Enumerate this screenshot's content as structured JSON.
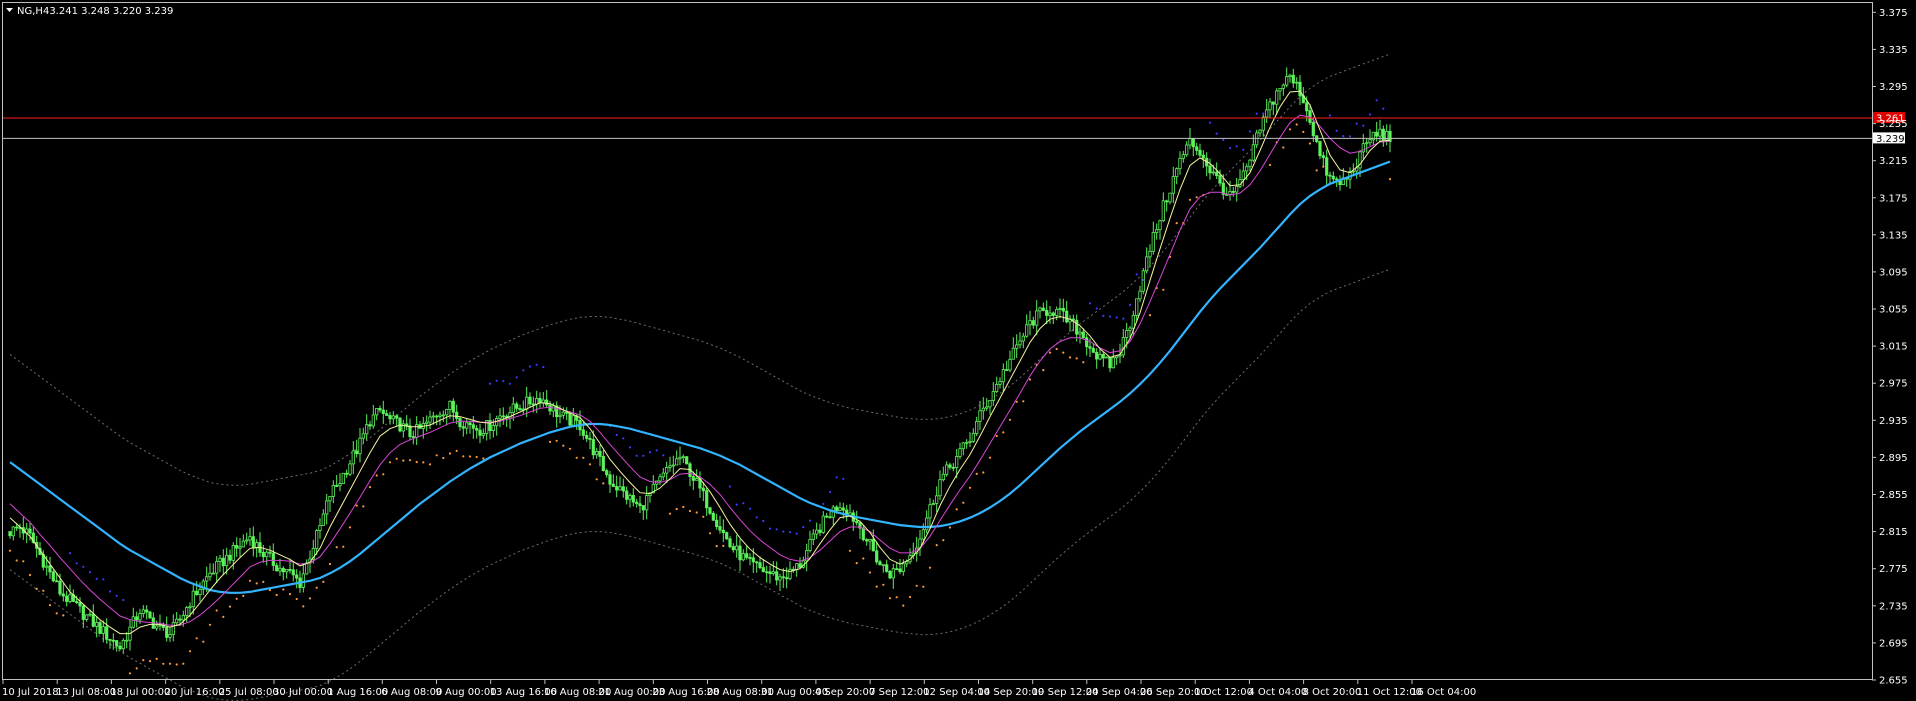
{
  "window": {
    "symbol": "NG",
    "timeframe": "H4",
    "ohlc": "3.241 3.248 3.220 3.239",
    "menu_icon": "triangle-down-icon"
  },
  "colors": {
    "background": "#000000",
    "frame": "#c0c0c0",
    "candle": "#5df25d",
    "ma_slow": "#32b4ff",
    "ma_mid": "#d946d9",
    "ma_fast": "#f5f5a0",
    "envelope": "#6e6e6e",
    "sar_up": "#3b3bff",
    "sar_down": "#ff9a3c",
    "hline_red": "#ff2020",
    "hline_gray": "#c0c0c0",
    "label_red_bg": "#e00000",
    "label_gray_bg": "#ffffff"
  },
  "chart_data": {
    "type": "line",
    "ylim": [
      2.655,
      3.385
    ],
    "y_ticks": [
      "3.375",
      "3.335",
      "3.295",
      "3.255",
      "3.215",
      "3.175",
      "3.135",
      "3.095",
      "3.055",
      "3.015",
      "2.975",
      "2.935",
      "2.895",
      "2.855",
      "2.815",
      "2.775",
      "2.735",
      "2.695",
      "2.655"
    ],
    "x_ticks": [
      "10 Jul 2018",
      "13 Jul 08:00",
      "18 Jul 00:00",
      "20 Jul 16:00",
      "25 Jul 08:00",
      "30 Jul 00:00",
      "1 Aug 16:00",
      "6 Aug 08:00",
      "9 Aug 00:00",
      "13 Aug 16:00",
      "16 Aug 08:00",
      "21 Aug 00:00",
      "23 Aug 16:00",
      "28 Aug 08:00",
      "31 Aug 00:00",
      "4 Sep 20:00",
      "7 Sep 12:00",
      "12 Sep 04:00",
      "14 Sep 20:00",
      "19 Sep 12:00",
      "24 Sep 04:00",
      "26 Sep 20:00",
      "1 Oct 12:00",
      "4 Oct 04:00",
      "8 Oct 20:00",
      "11 Oct 12:00",
      "16 Oct 04:00"
    ],
    "price_levels": [
      {
        "value": 3.261,
        "label": "3.261",
        "color": "red"
      },
      {
        "value": 3.239,
        "label": "3.239",
        "color": "gray"
      }
    ],
    "series": [
      {
        "role": "price",
        "values": [
          2.815,
          2.82,
          2.81,
          2.79,
          2.77,
          2.75,
          2.74,
          2.73,
          2.72,
          2.71,
          2.7,
          2.69,
          2.71,
          2.73,
          2.72,
          2.71,
          2.705,
          2.72,
          2.74,
          2.755,
          2.77,
          2.78,
          2.79,
          2.8,
          2.81,
          2.795,
          2.785,
          2.775,
          2.77,
          2.76,
          2.79,
          2.82,
          2.855,
          2.87,
          2.89,
          2.91,
          2.935,
          2.945,
          2.935,
          2.93,
          2.92,
          2.925,
          2.935,
          2.945,
          2.95,
          2.935,
          2.93,
          2.925,
          2.93,
          2.94,
          2.945,
          2.95,
          2.955,
          2.96,
          2.95,
          2.94,
          2.935,
          2.93,
          2.91,
          2.89,
          2.87,
          2.86,
          2.85,
          2.84,
          2.855,
          2.87,
          2.885,
          2.895,
          2.88,
          2.86,
          2.84,
          2.82,
          2.8,
          2.79,
          2.78,
          2.775,
          2.77,
          2.765,
          2.77,
          2.78,
          2.8,
          2.82,
          2.835,
          2.845,
          2.835,
          2.82,
          2.8,
          2.78,
          2.77,
          2.775,
          2.79,
          2.81,
          2.84,
          2.87,
          2.885,
          2.9,
          2.915,
          2.94,
          2.96,
          2.98,
          3.0,
          3.02,
          3.04,
          3.05,
          3.055,
          3.05,
          3.04,
          3.03,
          3.015,
          3.0,
          2.995,
          3.01,
          3.04,
          3.08,
          3.12,
          3.155,
          3.185,
          3.215,
          3.235,
          3.225,
          3.205,
          3.19,
          3.175,
          3.19,
          3.215,
          3.25,
          3.275,
          3.295,
          3.305,
          3.29,
          3.26,
          3.22,
          3.195,
          3.19,
          3.2,
          3.22,
          3.24,
          3.245,
          3.239
        ]
      },
      {
        "role": "ma_fast",
        "values": [
          2.83,
          2.82,
          2.81,
          2.795,
          2.78,
          2.765,
          2.75,
          2.74,
          2.73,
          2.72,
          2.712,
          2.705,
          2.705,
          2.712,
          2.715,
          2.715,
          2.712,
          2.715,
          2.725,
          2.738,
          2.752,
          2.765,
          2.776,
          2.787,
          2.797,
          2.798,
          2.795,
          2.79,
          2.785,
          2.778,
          2.782,
          2.797,
          2.82,
          2.84,
          2.86,
          2.88,
          2.9,
          2.918,
          2.926,
          2.93,
          2.928,
          2.928,
          2.93,
          2.935,
          2.94,
          2.939,
          2.936,
          2.933,
          2.932,
          2.935,
          2.939,
          2.944,
          2.949,
          2.954,
          2.953,
          2.948,
          2.943,
          2.938,
          2.926,
          2.91,
          2.893,
          2.88,
          2.868,
          2.857,
          2.856,
          2.862,
          2.872,
          2.883,
          2.882,
          2.872,
          2.858,
          2.841,
          2.823,
          2.808,
          2.796,
          2.787,
          2.78,
          2.774,
          2.772,
          2.775,
          2.786,
          2.802,
          2.817,
          2.83,
          2.832,
          2.826,
          2.814,
          2.798,
          2.785,
          2.78,
          2.785,
          2.797,
          2.818,
          2.843,
          2.864,
          2.882,
          2.898,
          2.918,
          2.939,
          2.959,
          2.979,
          2.999,
          3.019,
          3.034,
          3.044,
          3.047,
          3.044,
          3.037,
          3.026,
          3.012,
          3.003,
          3.006,
          3.023,
          3.051,
          3.086,
          3.12,
          3.153,
          3.184,
          3.21,
          3.218,
          3.212,
          3.201,
          3.188,
          3.189,
          3.202,
          3.226,
          3.251,
          3.273,
          3.289,
          3.29,
          3.275,
          3.248,
          3.221,
          3.205,
          3.202,
          3.211,
          3.226,
          3.236,
          3.237
        ]
      },
      {
        "role": "ma_mid",
        "values": [
          2.845,
          2.835,
          2.825,
          2.812,
          2.8,
          2.787,
          2.775,
          2.763,
          2.752,
          2.742,
          2.733,
          2.724,
          2.72,
          2.718,
          2.717,
          2.716,
          2.714,
          2.714,
          2.718,
          2.725,
          2.734,
          2.744,
          2.755,
          2.766,
          2.777,
          2.782,
          2.784,
          2.784,
          2.783,
          2.78,
          2.781,
          2.788,
          2.802,
          2.818,
          2.835,
          2.852,
          2.87,
          2.887,
          2.9,
          2.909,
          2.914,
          2.918,
          2.922,
          2.927,
          2.932,
          2.934,
          2.934,
          2.933,
          2.933,
          2.934,
          2.937,
          2.94,
          2.944,
          2.948,
          2.949,
          2.947,
          2.944,
          2.941,
          2.934,
          2.922,
          2.909,
          2.897,
          2.885,
          2.874,
          2.869,
          2.868,
          2.871,
          2.877,
          2.878,
          2.874,
          2.866,
          2.855,
          2.841,
          2.828,
          2.816,
          2.806,
          2.798,
          2.79,
          2.785,
          2.783,
          2.787,
          2.795,
          2.805,
          2.815,
          2.82,
          2.82,
          2.815,
          2.806,
          2.797,
          2.792,
          2.792,
          2.797,
          2.81,
          2.827,
          2.844,
          2.86,
          2.875,
          2.892,
          2.91,
          2.928,
          2.946,
          2.964,
          2.983,
          2.999,
          3.012,
          3.02,
          3.024,
          3.024,
          3.02,
          3.013,
          3.008,
          3.01,
          3.02,
          3.039,
          3.063,
          3.088,
          3.114,
          3.14,
          3.163,
          3.176,
          3.181,
          3.181,
          3.178,
          3.18,
          3.189,
          3.204,
          3.222,
          3.24,
          3.256,
          3.264,
          3.262,
          3.252,
          3.239,
          3.229,
          3.223,
          3.225,
          3.23,
          3.235,
          3.236
        ]
      },
      {
        "role": "ma_slow",
        "values": [
          2.89,
          2.882,
          2.874,
          2.866,
          2.858,
          2.85,
          2.842,
          2.834,
          2.826,
          2.818,
          2.81,
          2.802,
          2.795,
          2.789,
          2.783,
          2.777,
          2.771,
          2.765,
          2.76,
          2.756,
          2.752,
          2.75,
          2.749,
          2.749,
          2.75,
          2.752,
          2.754,
          2.756,
          2.758,
          2.76,
          2.762,
          2.765,
          2.77,
          2.776,
          2.783,
          2.791,
          2.8,
          2.809,
          2.818,
          2.827,
          2.836,
          2.845,
          2.853,
          2.861,
          2.869,
          2.876,
          2.883,
          2.889,
          2.895,
          2.9,
          2.905,
          2.91,
          2.914,
          2.918,
          2.922,
          2.925,
          2.928,
          2.93,
          2.931,
          2.931,
          2.93,
          2.928,
          2.926,
          2.923,
          2.92,
          2.917,
          2.914,
          2.911,
          2.908,
          2.905,
          2.901,
          2.897,
          2.892,
          2.887,
          2.881,
          2.875,
          2.869,
          2.863,
          2.857,
          2.851,
          2.846,
          2.842,
          2.838,
          2.835,
          2.832,
          2.83,
          2.828,
          2.826,
          2.824,
          2.822,
          2.821,
          2.82,
          2.82,
          2.821,
          2.823,
          2.826,
          2.83,
          2.835,
          2.841,
          2.848,
          2.856,
          2.865,
          2.875,
          2.885,
          2.895,
          2.905,
          2.914,
          2.923,
          2.931,
          2.939,
          2.947,
          2.955,
          2.964,
          2.974,
          2.985,
          2.997,
          3.01,
          3.024,
          3.038,
          3.052,
          3.065,
          3.077,
          3.088,
          3.099,
          3.11,
          3.121,
          3.133,
          3.145,
          3.157,
          3.168,
          3.177,
          3.184,
          3.19,
          3.194,
          3.198,
          3.202,
          3.206,
          3.21,
          3.214
        ]
      },
      {
        "role": "envelope_upper",
        "values": [
          3.006,
          2.998,
          2.99,
          2.982,
          2.974,
          2.966,
          2.958,
          2.95,
          2.942,
          2.934,
          2.926,
          2.918,
          2.911,
          2.905,
          2.899,
          2.893,
          2.887,
          2.881,
          2.876,
          2.872,
          2.868,
          2.866,
          2.865,
          2.865,
          2.866,
          2.868,
          2.87,
          2.872,
          2.874,
          2.876,
          2.878,
          2.881,
          2.886,
          2.892,
          2.899,
          2.907,
          2.916,
          2.925,
          2.934,
          2.943,
          2.952,
          2.961,
          2.969,
          2.977,
          2.985,
          2.992,
          2.999,
          3.005,
          3.011,
          3.016,
          3.021,
          3.026,
          3.03,
          3.034,
          3.038,
          3.041,
          3.044,
          3.046,
          3.047,
          3.047,
          3.046,
          3.044,
          3.042,
          3.039,
          3.036,
          3.033,
          3.03,
          3.027,
          3.024,
          3.021,
          3.017,
          3.013,
          3.008,
          3.003,
          2.997,
          2.991,
          2.985,
          2.979,
          2.973,
          2.967,
          2.962,
          2.958,
          2.954,
          2.951,
          2.948,
          2.946,
          2.944,
          2.942,
          2.94,
          2.938,
          2.937,
          2.936,
          2.936,
          2.937,
          2.939,
          2.942,
          2.946,
          2.951,
          2.957,
          2.964,
          2.972,
          2.981,
          2.991,
          3.001,
          3.011,
          3.021,
          3.03,
          3.039,
          3.047,
          3.055,
          3.063,
          3.071,
          3.08,
          3.09,
          3.101,
          3.113,
          3.126,
          3.14,
          3.154,
          3.168,
          3.181,
          3.193,
          3.204,
          3.215,
          3.226,
          3.237,
          3.249,
          3.261,
          3.273,
          3.284,
          3.293,
          3.3,
          3.306,
          3.31,
          3.314,
          3.318,
          3.322,
          3.326,
          3.33
        ]
      },
      {
        "role": "envelope_lower",
        "values": [
          2.774,
          2.766,
          2.758,
          2.75,
          2.742,
          2.734,
          2.726,
          2.718,
          2.71,
          2.702,
          2.694,
          2.686,
          2.679,
          2.673,
          2.667,
          2.661,
          2.655,
          2.649,
          2.644,
          2.64,
          2.636,
          2.634,
          2.633,
          2.633,
          2.634,
          2.636,
          2.638,
          2.64,
          2.642,
          2.644,
          2.646,
          2.649,
          2.654,
          2.66,
          2.667,
          2.675,
          2.684,
          2.693,
          2.702,
          2.711,
          2.72,
          2.729,
          2.737,
          2.745,
          2.753,
          2.76,
          2.767,
          2.773,
          2.779,
          2.784,
          2.789,
          2.794,
          2.798,
          2.802,
          2.806,
          2.809,
          2.812,
          2.814,
          2.815,
          2.815,
          2.814,
          2.812,
          2.81,
          2.807,
          2.804,
          2.801,
          2.798,
          2.795,
          2.792,
          2.789,
          2.785,
          2.781,
          2.776,
          2.771,
          2.765,
          2.759,
          2.753,
          2.747,
          2.741,
          2.735,
          2.73,
          2.726,
          2.722,
          2.719,
          2.716,
          2.714,
          2.712,
          2.71,
          2.708,
          2.706,
          2.705,
          2.704,
          2.704,
          2.705,
          2.707,
          2.71,
          2.714,
          2.719,
          2.725,
          2.732,
          2.74,
          2.749,
          2.759,
          2.769,
          2.779,
          2.789,
          2.798,
          2.807,
          2.815,
          2.823,
          2.831,
          2.839,
          2.848,
          2.858,
          2.869,
          2.881,
          2.894,
          2.908,
          2.922,
          2.936,
          2.949,
          2.961,
          2.972,
          2.983,
          2.994,
          3.005,
          3.017,
          3.029,
          3.041,
          3.052,
          3.061,
          3.068,
          3.074,
          3.078,
          3.082,
          3.086,
          3.09,
          3.094,
          3.098
        ]
      }
    ]
  }
}
